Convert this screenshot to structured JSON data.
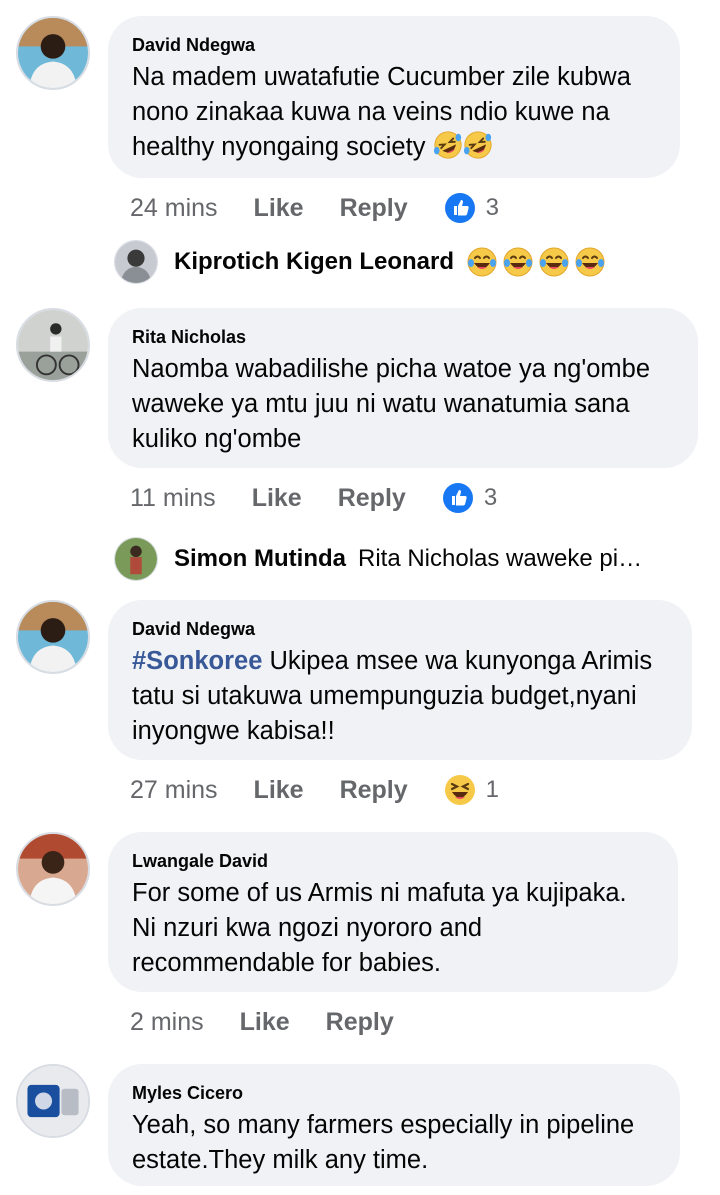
{
  "comments": [
    {
      "author": "David Ndegwa",
      "text": "Na madem uwatafutie Cucumber zile kubwa nono zinakaa kuwa na veins ndio kuwe na healthy nyongaing society",
      "time": "24 mins",
      "like_label": "Like",
      "reply_label": "Reply",
      "reaction_icon": "like-reaction-icon",
      "reaction_count": "3",
      "reply_preview": {
        "author": "Kiprotich Kigen Leonard",
        "text": "",
        "emoji_icon": "laughing-tears-emoji"
      }
    },
    {
      "author": "Rita Nicholas",
      "text": "Naomba wabadilishe picha watoe ya ng'ombe waweke ya mtu juu ni watu wanatumia sana kuliko ng'ombe",
      "time": "11 mins",
      "like_label": "Like",
      "reply_label": "Reply",
      "reaction_icon": "like-reaction-icon",
      "reaction_count": "3",
      "reply_preview": {
        "author": "Simon Mutinda",
        "text": "Rita Nicholas waweke pi…"
      }
    },
    {
      "author": "David Ndegwa",
      "hashtag": "#Sonkoree",
      "text": " Ukipea msee wa kunyonga Arimis tatu si utakuwa umempunguzia budget,nyani inyongwe kabisa!!",
      "time": "27 mins",
      "like_label": "Like",
      "reply_label": "Reply",
      "reaction_icon": "haha-reaction-icon",
      "reaction_count": "1"
    },
    {
      "author": "Lwangale David",
      "text": "For some of us Armis ni mafuta ya kujipaka. Ni nzuri kwa ngozi nyororo and recommendable for babies.",
      "time": "2 mins",
      "like_label": "Like",
      "reply_label": "Reply"
    },
    {
      "author": "Myles Cicero",
      "text": "Yeah, so many farmers especially in pipeline estate.They milk any time."
    }
  ],
  "colors": {
    "bubble": "#f0f2f5",
    "meta_text": "#65676b",
    "like_blue": "#1877f2",
    "hashtag": "#385898",
    "emoji_yellow": "#f7b928"
  }
}
